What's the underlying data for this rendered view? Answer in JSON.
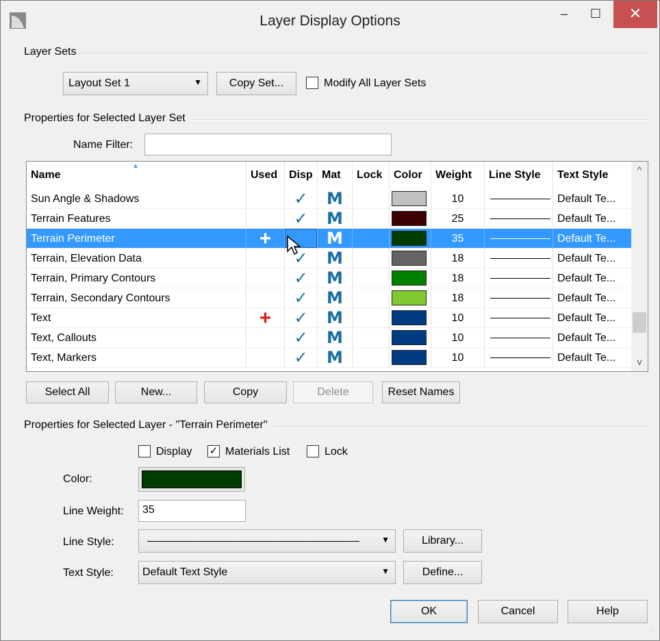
{
  "window": {
    "title": "Layer Display Options",
    "min_symbol": "–",
    "max_symbol": "☐",
    "close_symbol": "✕"
  },
  "layer_sets": {
    "group_label": "Layer Sets",
    "selected_set": "Layout Set 1",
    "copy_set_label": "Copy Set...",
    "modify_all_label": "Modify All Layer Sets",
    "modify_all_checked": false
  },
  "props_set": {
    "group_label": "Properties for Selected Layer Set",
    "name_filter_label": "Name Filter:",
    "name_filter_value": ""
  },
  "table": {
    "columns": [
      "Name",
      "Used",
      "Disp",
      "Mat",
      "Lock",
      "Color",
      "Weight",
      "Line Style",
      "Text Style"
    ],
    "rows": [
      {
        "name": "Sun Angle & Shadows",
        "used": "",
        "disp": "✓",
        "mat": "M",
        "lock": "",
        "color": "#c0c0c0",
        "weight": "10",
        "text_style": "Default Te..."
      },
      {
        "name": "Terrain Features",
        "used": "",
        "disp": "✓",
        "mat": "M",
        "lock": "",
        "color": "#3c0000",
        "weight": "25",
        "text_style": "Default Te..."
      },
      {
        "name": "Terrain Perimeter",
        "used": "+",
        "disp": "",
        "mat": "M",
        "lock": "",
        "color": "#003c00",
        "weight": "35",
        "text_style": "Default Te...",
        "selected": true
      },
      {
        "name": "Terrain, Elevation Data",
        "used": "",
        "disp": "✓",
        "mat": "M",
        "lock": "",
        "color": "#646464",
        "weight": "18",
        "text_style": "Default Te..."
      },
      {
        "name": "Terrain, Primary Contours",
        "used": "",
        "disp": "✓",
        "mat": "M",
        "lock": "",
        "color": "#008000",
        "weight": "18",
        "text_style": "Default Te..."
      },
      {
        "name": "Terrain, Secondary Contours",
        "used": "",
        "disp": "✓",
        "mat": "M",
        "lock": "",
        "color": "#80c830",
        "weight": "18",
        "text_style": "Default Te..."
      },
      {
        "name": "Text",
        "used": "+",
        "disp": "✓",
        "mat": "M",
        "lock": "",
        "color": "#003c82",
        "weight": "10",
        "text_style": "Default Te..."
      },
      {
        "name": "Text,  Callouts",
        "used": "",
        "disp": "✓",
        "mat": "M",
        "lock": "",
        "color": "#003c82",
        "weight": "10",
        "text_style": "Default Te..."
      },
      {
        "name": "Text,  Markers",
        "used": "",
        "disp": "✓",
        "mat": "M",
        "lock": "",
        "color": "#003c82",
        "weight": "10",
        "text_style": "Default Te..."
      }
    ],
    "used_plus_color": "#d82020",
    "scroll_up": "^",
    "scroll_down": "v"
  },
  "table_buttons": {
    "select_all": "Select All",
    "new": "New...",
    "copy": "Copy",
    "delete": "Delete",
    "reset_names": "Reset Names"
  },
  "props_layer": {
    "group_label": "Properties for Selected Layer - \"Terrain Perimeter\"",
    "display_label": "Display",
    "display_checked": false,
    "materials_label": "Materials List",
    "materials_checked": true,
    "lock_label": "Lock",
    "lock_checked": false,
    "color_label": "Color:",
    "color_value": "#003c00",
    "line_weight_label": "Line Weight:",
    "line_weight_value": "35",
    "line_style_label": "Line Style:",
    "library_label": "Library...",
    "text_style_label": "Text Style:",
    "text_style_value": "Default Text Style",
    "define_label": "Define..."
  },
  "footer": {
    "ok": "OK",
    "cancel": "Cancel",
    "help": "Help"
  }
}
